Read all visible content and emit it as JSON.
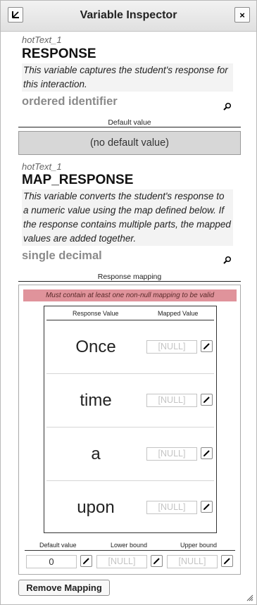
{
  "header": {
    "title": "Variable Inspector",
    "close_label": "×"
  },
  "variables": [
    {
      "id": "hotText_1",
      "name": "RESPONSE",
      "description": "This variable captures the student's response for this interaction.",
      "type": "ordered identifier",
      "section_label": "Default value",
      "default_value": "(no default value)"
    },
    {
      "id": "hotText_1",
      "name": "MAP_RESPONSE",
      "description": "This variable converts the student's response to a numeric value using the map defined below. If the response contains multiple parts, the mapped values are added together.",
      "type": "single decimal",
      "section_label": "Response mapping"
    }
  ],
  "mapping": {
    "warning": "Must contain at least one non-null mapping to be valid",
    "col_response": "Response Value",
    "col_mapped": "Mapped Value",
    "rows": [
      {
        "response": "Once",
        "mapped": "[NULL]"
      },
      {
        "response": "time",
        "mapped": "[NULL]"
      },
      {
        "response": "a",
        "mapped": "[NULL]"
      },
      {
        "response": "upon",
        "mapped": "[NULL]"
      }
    ],
    "bounds": {
      "default_label": "Default value",
      "lower_label": "Lower bound",
      "upper_label": "Upper bound",
      "default_value": "0",
      "lower_value": "[NULL]",
      "upper_value": "[NULL]"
    }
  },
  "footer": {
    "remove_label": "Remove Mapping"
  },
  "icons": {
    "header_left": "export-arrow-icon",
    "search": "magnifier-icon",
    "edit": "pencil-icon",
    "resize": "resize-grip-icon"
  },
  "colors": {
    "warning_bg": "#e0939b",
    "default_box_bg": "#d7d7d7",
    "type_text": "#8a8a8a"
  }
}
